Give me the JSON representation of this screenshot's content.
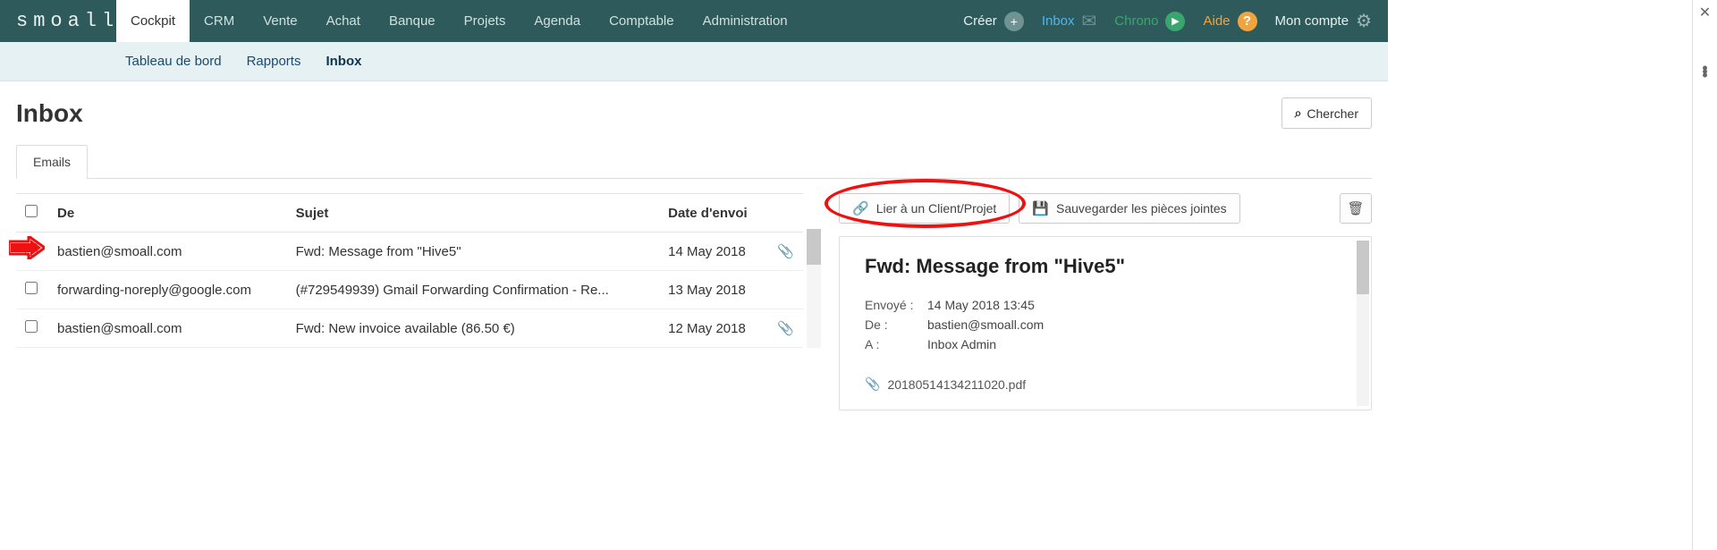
{
  "logo": "smoall",
  "nav": {
    "tabs": [
      "Cockpit",
      "CRM",
      "Vente",
      "Achat",
      "Banque",
      "Projets",
      "Agenda",
      "Comptable",
      "Administration"
    ],
    "active": "Cockpit",
    "right": {
      "creer": "Créer",
      "inbox": "Inbox",
      "chrono": "Chrono",
      "aide": "Aide",
      "compte": "Mon compte"
    }
  },
  "subnav": {
    "items": [
      "Tableau de bord",
      "Rapports",
      "Inbox"
    ],
    "active": "Inbox"
  },
  "page": {
    "title": "Inbox",
    "search": "Chercher"
  },
  "tabs": {
    "emails": "Emails"
  },
  "actions": {
    "link": "Lier à un Client/Projet",
    "save": "Sauvegarder les pièces jointes"
  },
  "table": {
    "headers": {
      "from": "De",
      "subject": "Sujet",
      "sent": "Date d'envoi"
    },
    "rows": [
      {
        "from": "bastien@smoall.com",
        "subject": "Fwd: Message from \"Hive5\"",
        "sent": "14 May 2018",
        "attach": true
      },
      {
        "from": "forwarding-noreply@google.com",
        "subject": "(#729549939) Gmail Forwarding Confirmation - Re...",
        "sent": "13 May 2018",
        "attach": false
      },
      {
        "from": "bastien@smoall.com",
        "subject": "Fwd: New invoice available (86.50 €)",
        "sent": "12 May 2018",
        "attach": true
      }
    ]
  },
  "detail": {
    "title": "Fwd: Message from \"Hive5\"",
    "labels": {
      "sent": "Envoyé :",
      "from": "De :",
      "to": "A :"
    },
    "sent": "14 May 2018 13:45",
    "from": "bastien@smoall.com",
    "to": "Inbox Admin",
    "attachment": "20180514134211020.pdf"
  }
}
